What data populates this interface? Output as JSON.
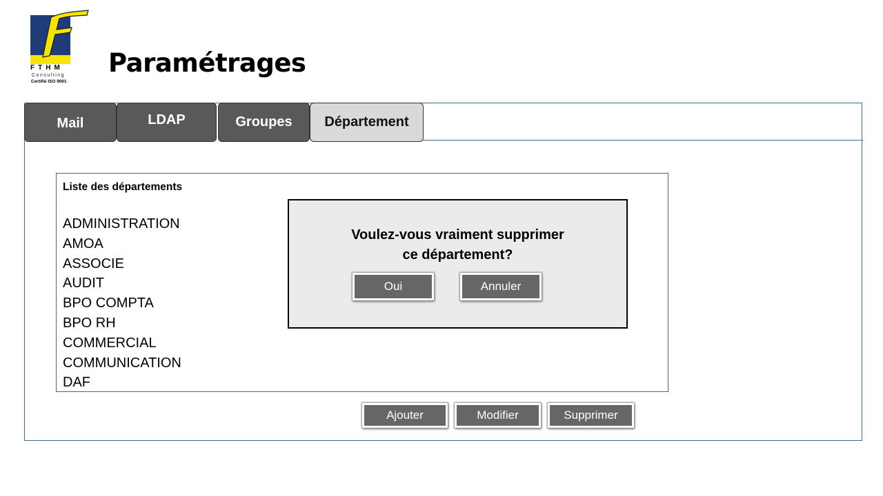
{
  "logo": {
    "letter": "F",
    "name": "FTHM",
    "subtitle": "Consulting",
    "certification": "Certifié ISO 9001",
    "colors": {
      "box": "#1f3c78",
      "bar": "#f5e400",
      "letter": "#f5e400"
    }
  },
  "page": {
    "title": "Paramétrages"
  },
  "tabs": [
    {
      "label": "Mail",
      "active": false
    },
    {
      "label": "LDAP",
      "active": false
    },
    {
      "label": "Groupes",
      "active": false
    },
    {
      "label": "Département",
      "active": true
    }
  ],
  "department_list": {
    "title": "Liste des départements",
    "items": [
      "ADMINISTRATION",
      "AMOA",
      "ASSOCIE",
      "AUDIT",
      "BPO COMPTA",
      "BPO RH",
      "COMMERCIAL",
      "COMMUNICATION",
      "DAF"
    ]
  },
  "dialog": {
    "message_line1": "Voulez-vous vraiment supprimer",
    "message_line2": "ce département?",
    "confirm_label": "Oui",
    "cancel_label": "Annuler"
  },
  "actions": {
    "add_label": "Ajouter",
    "edit_label": "Modifier",
    "delete_label": "Supprimer"
  },
  "colors": {
    "border": "#3f6e8c",
    "tab_inactive": "#595959",
    "tab_active": "#d9d9d9",
    "button": "#666666",
    "dialog_bg": "#ebebeb"
  }
}
